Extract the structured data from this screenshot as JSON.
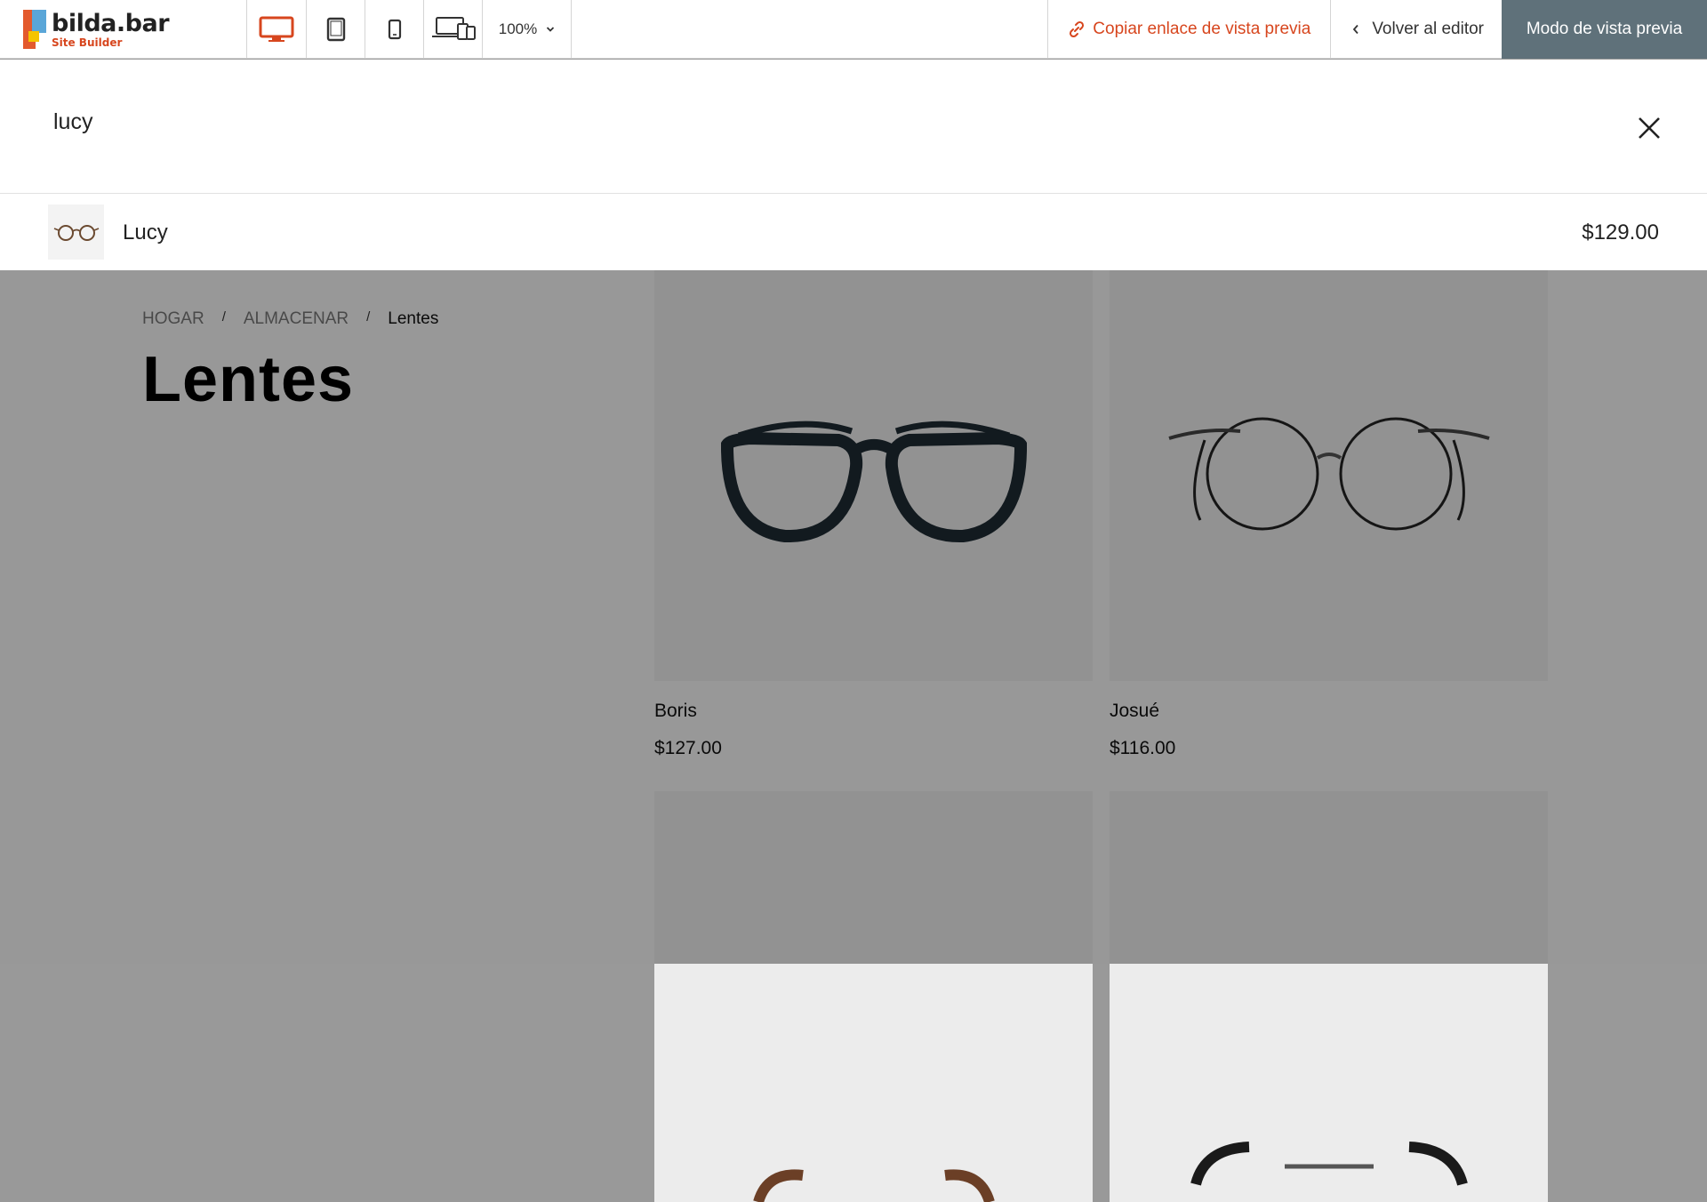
{
  "brand": {
    "name": "bilda.bar",
    "subtitle": "Site Builder"
  },
  "toolbar": {
    "devices": [
      "desktop-icon",
      "tablet-icon",
      "phone-icon",
      "all-devices-icon"
    ],
    "active_device": "desktop",
    "zoom": "100%",
    "copy_link_label": "Copiar enlace de vista previa",
    "back_label": "Volver al editor",
    "preview_mode_label": "Modo de vista previa",
    "accent_color": "#d7461e",
    "preview_bg": "#5f717a"
  },
  "search": {
    "query": "lucy",
    "results": [
      {
        "name": "Lucy",
        "price": "$129.00"
      }
    ]
  },
  "page": {
    "breadcrumb": [
      "HOGAR",
      "ALMACENAR",
      "Lentes"
    ],
    "breadcrumb_separator": "/",
    "title": "Lentes",
    "products": [
      {
        "name": "Boris",
        "price": "$127.00"
      },
      {
        "name": "Josué",
        "price": "$116.00"
      },
      {
        "name": "",
        "price": ""
      },
      {
        "name": "",
        "price": ""
      }
    ]
  }
}
